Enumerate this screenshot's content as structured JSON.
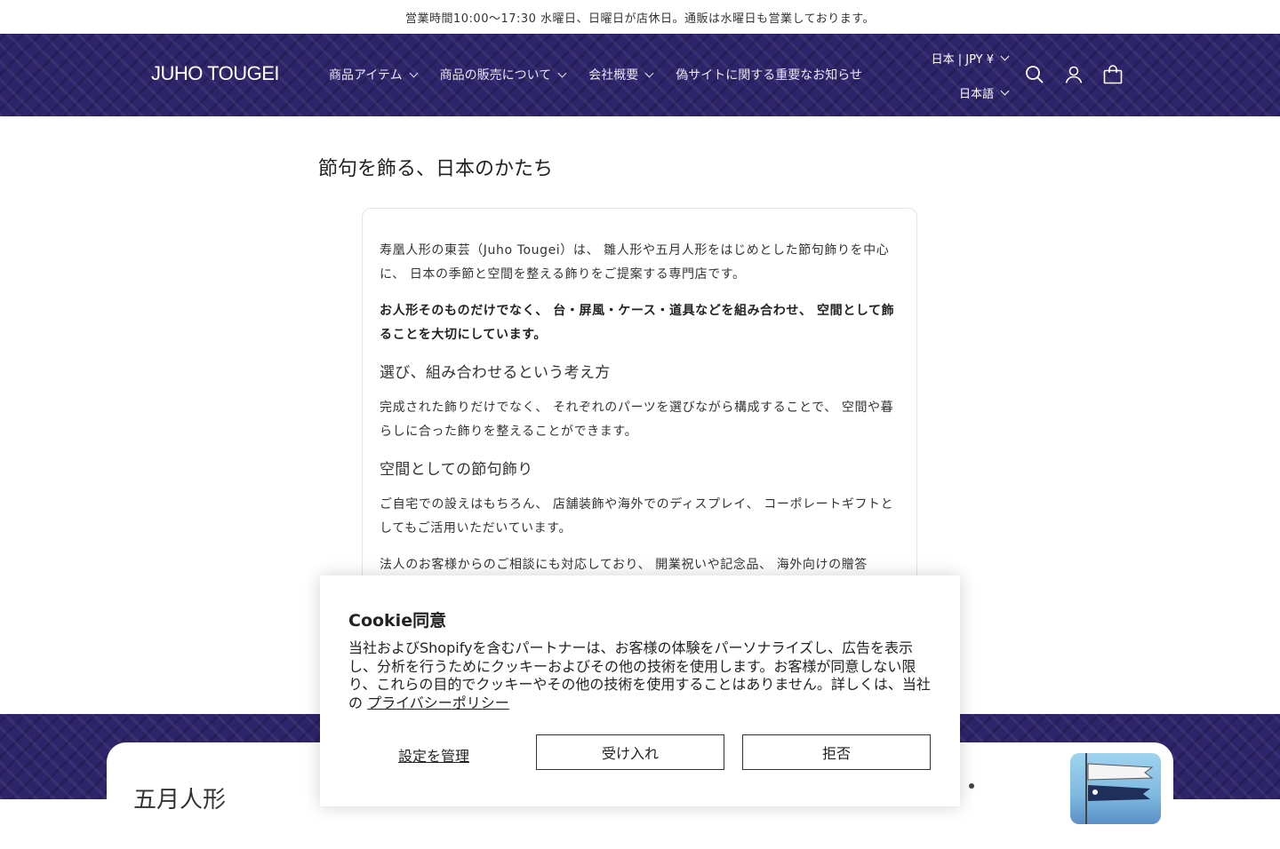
{
  "announcement": "営業時間10:00〜17:30 水曜日、日曜日が店休日。通販は水曜日も営業しております。",
  "header": {
    "logo": "JUHO TOUGEI",
    "nav": [
      {
        "label": "商品アイテム",
        "dropdown": true
      },
      {
        "label": "商品の販売について",
        "dropdown": true
      },
      {
        "label": "会社概要",
        "dropdown": true
      },
      {
        "label": "偽サイトに関する重要なお知らせ",
        "dropdown": false
      }
    ],
    "currency": "日本 | JPY ¥",
    "language": "日本語",
    "icons": [
      "search-icon",
      "account-icon",
      "cart-icon"
    ],
    "background_color": "#2e246a"
  },
  "main": {
    "title": "節句を飾る、日本のかたち",
    "intro": "寿凰人形の東芸（Juho Tougei）は、 雛人形や五月人形をはじめとした節句飾りを中心に、 日本の季節と空間を整える飾りをご提案する専門店です。",
    "emphasis": "お人形そのものだけでなく、 台・屏風・ケース・道具などを組み合わせ、 空間として飾ることを大切にしています。",
    "section1_heading": "選び、組み合わせるという考え方",
    "section1_text": "完成された飾りだけでなく、 それぞれのパーツを選びながら構成することで、 空間や暮らしに合った飾りを整えることができます。",
    "section2_heading": "空間としての節句飾り",
    "section2_text": "ご自宅での設えはもちろん、 店舗装飾や海外でのディスプレイ、 コーポレートギフトとしてもご活用いただいています。",
    "section2_text2": "法人のお客様からのご相談にも対応しており、 開業祝いや記念品、 海外向けの贈答"
  },
  "bottom": {
    "title": "五月人形"
  },
  "cookie": {
    "title": "Cookie同意",
    "body": "当社およびShopifyを含むパートナーは、お客様の体験をパーソナライズし、広告を表示し、分析を行うためにクッキーおよびその他の技術を使用します。お客様が同意しない限り、これらの目的でクッキーやその他の技術を使用することはありません。詳しくは、当社の",
    "privacy_link": "プライバシーポリシー",
    "manage": "設定を管理",
    "accept": "受け入れ",
    "decline": "拒否"
  }
}
